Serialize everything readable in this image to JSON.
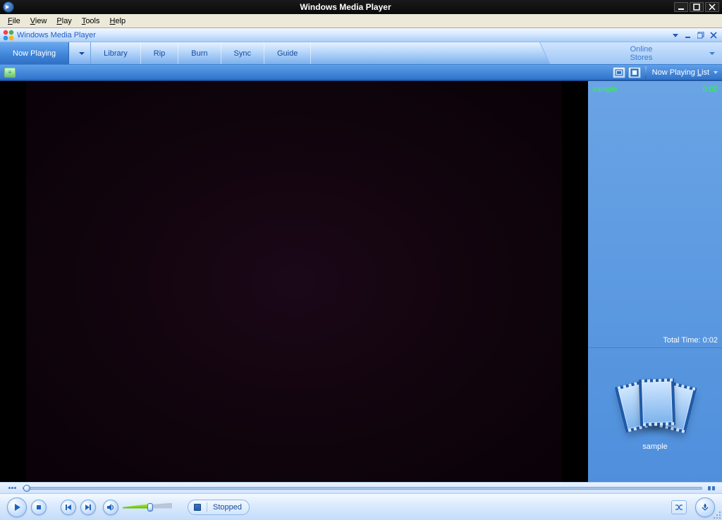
{
  "window": {
    "title": "Windows Media Player"
  },
  "menubar": {
    "items": [
      {
        "label": "File",
        "hotkey": "F"
      },
      {
        "label": "View",
        "hotkey": "V"
      },
      {
        "label": "Play",
        "hotkey": "P"
      },
      {
        "label": "Tools",
        "hotkey": "T"
      },
      {
        "label": "Help",
        "hotkey": "H"
      }
    ]
  },
  "app_header": {
    "title": "Windows Media Player"
  },
  "tabs": {
    "items": [
      {
        "label": "Now Playing",
        "active": true,
        "has_menu": true
      },
      {
        "label": "Library"
      },
      {
        "label": "Rip"
      },
      {
        "label": "Burn"
      },
      {
        "label": "Sync"
      },
      {
        "label": "Guide"
      }
    ],
    "online_stores": {
      "line1": "Online",
      "line2": "Stores"
    }
  },
  "sub_toolbar": {
    "now_playing_label": "Now Playing List"
  },
  "playlist": {
    "rows": [
      {
        "title": "sample",
        "duration": "0:02"
      }
    ],
    "total_label": "Total Time: 0:02"
  },
  "art": {
    "caption": "sample"
  },
  "transport": {
    "status": "Stopped"
  }
}
